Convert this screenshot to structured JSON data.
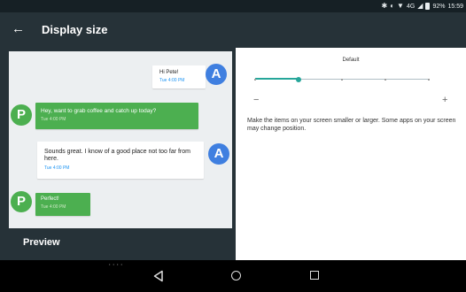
{
  "status_bar": {
    "signal_label": "4G",
    "battery_text": "92%",
    "time": "15:59",
    "icons": [
      "bluetooth-icon",
      "data-saver-icon",
      "wifi-icon",
      "signal-icon",
      "battery-icon"
    ]
  },
  "header": {
    "title": "Display size",
    "back_icon": "arrow-left-icon"
  },
  "preview": {
    "label": "Preview",
    "messages": [
      {
        "sender": "A",
        "text": "Hi Pete!",
        "time": "Tue 4:00 PM"
      },
      {
        "sender": "P",
        "text": "Hey, want to grab coffee and catch up today?",
        "time": "Tue 4:00 PM"
      },
      {
        "sender": "A",
        "text": "Sounds great. I know of a good place not too far from here.",
        "time": "Tue 4:00 PM"
      },
      {
        "sender": "P",
        "text": "Perfect!",
        "time": "Tue 4:00 PM"
      }
    ]
  },
  "settings": {
    "current_value": "Default",
    "slider": {
      "steps": 5,
      "current_step": 1
    },
    "minus_label": "−",
    "plus_label": "+",
    "description": "Make the items on your screen smaller or larger. Some apps on your screen may change position."
  },
  "colors": {
    "app_bar": "#263238",
    "status_bar": "#162025",
    "accent": "#26a69a",
    "bubble_green": "#4caf50",
    "avatar_blue": "#3f7fe0"
  },
  "nav": {
    "dots": "• • • •"
  }
}
